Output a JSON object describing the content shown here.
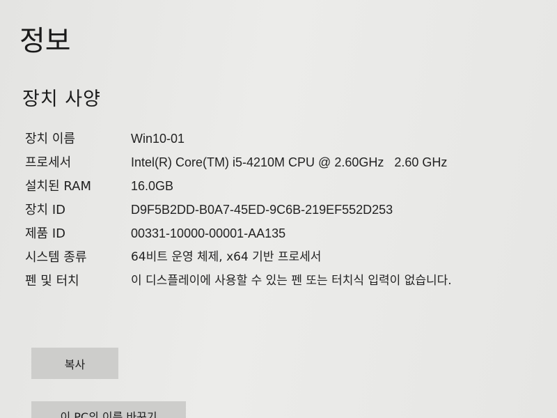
{
  "page": {
    "title": "정보"
  },
  "device_specs": {
    "heading": "장치 사양",
    "rows": [
      {
        "label": "장치 이름",
        "value": "Win10-01"
      },
      {
        "label": "프로세서",
        "value": "Intel(R) Core(TM) i5-4210M CPU @ 2.60GHz   2.60 GHz"
      },
      {
        "label": "설치된 RAM",
        "value": "16.0GB"
      },
      {
        "label": "장치 ID",
        "value": "D9F5B2DD-B0A7-45ED-9C6B-219EF552D253"
      },
      {
        "label": "제품 ID",
        "value": "00331-10000-00001-AA135"
      },
      {
        "label": "시스템 종류",
        "value": "64비트 운영 체제, x64 기반 프로세서"
      },
      {
        "label": "펜 및 터치",
        "value": "이 디스플레이에 사용할 수 있는 펜 또는 터치식 입력이 없습니다."
      }
    ]
  },
  "buttons": {
    "copy_label": "복사",
    "rename_label": "이 PC의 이름 바꾸기"
  }
}
